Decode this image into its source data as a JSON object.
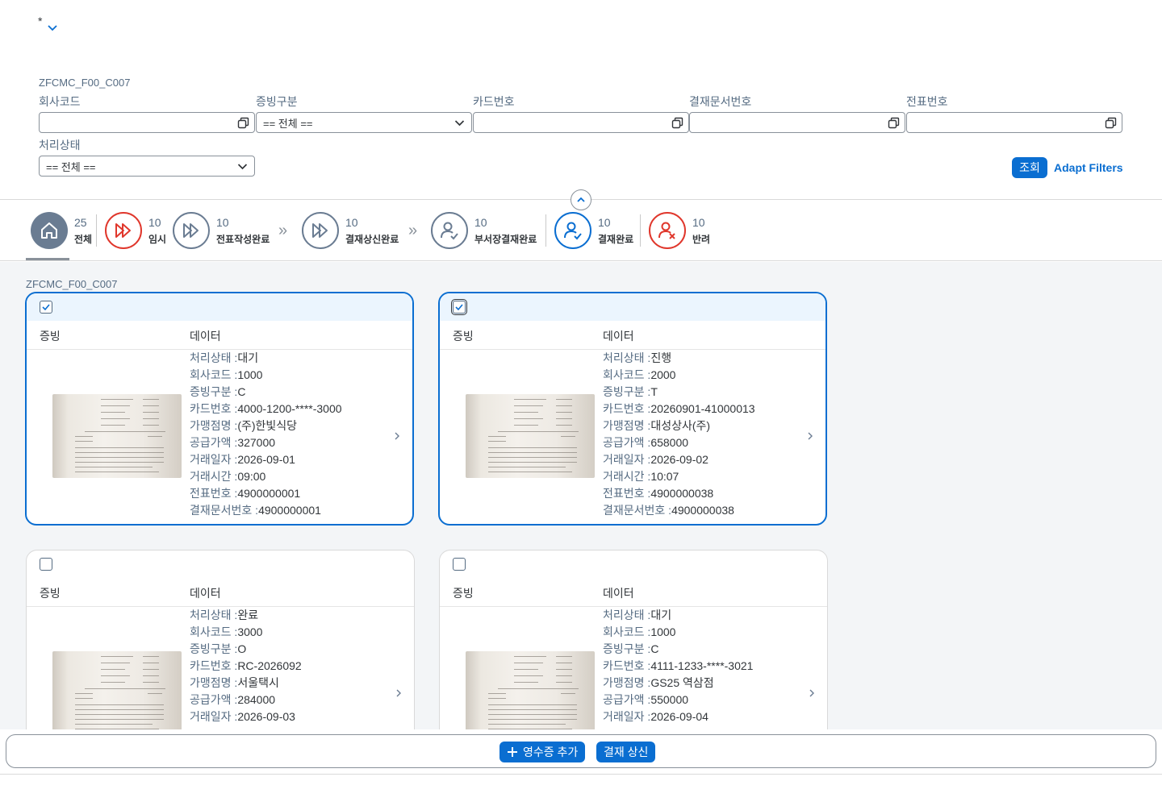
{
  "variant": {
    "marker": "*"
  },
  "filterbar": {
    "id": "ZFCMC_F00_C007",
    "fields": {
      "company_code": {
        "label": "회사코드",
        "value": ""
      },
      "evidence_type": {
        "label": "증빙구분",
        "value": "== 전체 =="
      },
      "card_number": {
        "label": "카드번호",
        "value": ""
      },
      "approval_doc": {
        "label": "결재문서번호",
        "value": ""
      },
      "slip_number": {
        "label": "전표번호",
        "value": ""
      },
      "status": {
        "label": "처리상태",
        "value": "== 전체 =="
      }
    },
    "go_label": "조회",
    "adapt_label": "Adapt Filters"
  },
  "process_flow": {
    "steps": [
      {
        "count": "25",
        "label": "전체",
        "icon": "home-icon"
      },
      {
        "count": "10",
        "label": "임시",
        "icon": "fast-forward-icon"
      },
      {
        "count": "10",
        "label": "전표작성완료",
        "icon": "fast-forward-icon"
      },
      {
        "count": "10",
        "label": "결재상신완료",
        "icon": "fast-forward-icon"
      },
      {
        "count": "10",
        "label": "부서장결재완료",
        "icon": "user-check-icon"
      },
      {
        "count": "10",
        "label": "결재완료",
        "icon": "user-check-icon"
      },
      {
        "count": "10",
        "label": "반려",
        "icon": "user-reject-icon"
      }
    ],
    "arrow": "»"
  },
  "list": {
    "id": "ZFCMC_F00_C007",
    "col_evidence": "증빙",
    "col_data": "데이터",
    "labels": {
      "status": "처리상태 :",
      "company": "회사코드 :",
      "evidence": "증빙구분 :",
      "card": "카드번호 :",
      "merchant": "가맹점명 :",
      "amount": "공급가액 :",
      "date": "거래일자 :",
      "time": "거래시간 :",
      "slip": "전표번호 :",
      "approval": "결재문서번호 :"
    },
    "cards": [
      {
        "selected": true,
        "status": "대기",
        "company": "1000",
        "evidence": "C",
        "card": "4000-1200-****-3000",
        "merchant": "(주)한빛식당",
        "amount": "327000",
        "date": "2026-09-01",
        "time": "09:00",
        "slip": "4900000001",
        "approval": "4900000001"
      },
      {
        "selected": true,
        "status": "진행",
        "company": "2000",
        "evidence": "T",
        "card": "20260901-41000013",
        "merchant": "대성상사(주)",
        "amount": "658000",
        "date": "2026-09-02",
        "time": "10:07",
        "slip": "4900000038",
        "approval": "4900000038"
      },
      {
        "selected": false,
        "status": "완료",
        "company": "3000",
        "evidence": "O",
        "card": "RC-2026092",
        "merchant": "서울택시",
        "amount": "284000",
        "date": "2026-09-03"
      },
      {
        "selected": false,
        "status": "대기",
        "company": "1000",
        "evidence": "C",
        "card": "4111-1233-****-3021",
        "merchant": "GS25 역삼점",
        "amount": "550000",
        "date": "2026-09-04"
      }
    ]
  },
  "footer": {
    "add_receipt": "영수증 추가",
    "submit": "결재 상신"
  },
  "colors": {
    "accent": "#0a6ed1",
    "reject": "#e0372c",
    "neutral": "#6a7c92"
  }
}
